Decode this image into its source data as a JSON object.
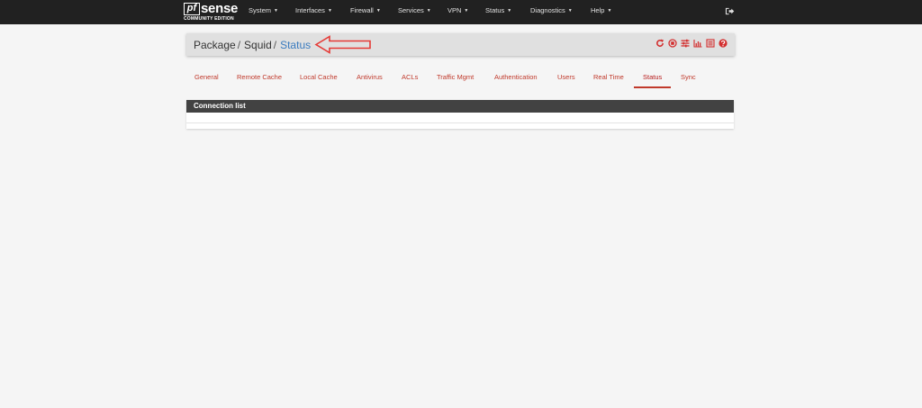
{
  "brand": {
    "logo_box": "pf",
    "logo_word": "sense",
    "edition": "COMMUNITY EDITION"
  },
  "nav": {
    "items": [
      {
        "label": "System"
      },
      {
        "label": "Interfaces"
      },
      {
        "label": "Firewall"
      },
      {
        "label": "Services"
      },
      {
        "label": "VPN"
      },
      {
        "label": "Status"
      },
      {
        "label": "Diagnostics"
      },
      {
        "label": "Help"
      }
    ],
    "logout_icon": "sign-out-icon"
  },
  "breadcrumb": {
    "items": [
      "Package",
      "Squid"
    ],
    "separator": "/",
    "current": "Status",
    "icons": [
      "reload-icon",
      "stop-icon",
      "sliders-icon",
      "chart-icon",
      "log-icon",
      "help-icon"
    ]
  },
  "tabs": {
    "items": [
      {
        "label": "General"
      },
      {
        "label": "Remote Cache"
      },
      {
        "label": "Local Cache"
      },
      {
        "label": "Antivirus"
      },
      {
        "label": "ACLs"
      },
      {
        "label": "Traffic Mgmt"
      },
      {
        "label": "Authentication"
      },
      {
        "label": "Users"
      },
      {
        "label": "Real Time"
      },
      {
        "label": "Status"
      },
      {
        "label": "Sync"
      }
    ],
    "active": "Status"
  },
  "connection_panel": {
    "title": "Connection list"
  },
  "colors": {
    "navbar": "#212121",
    "accent_red": "#c0392b",
    "link_blue": "#3a7bbf",
    "annotation_red": "#e53935"
  }
}
